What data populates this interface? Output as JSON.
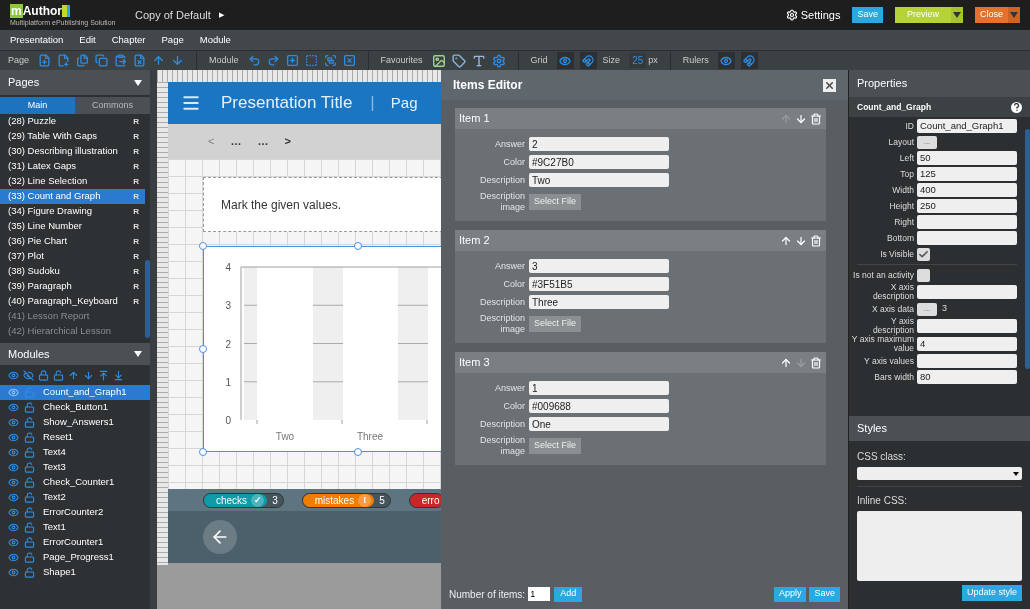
{
  "app": {
    "logo_mark": "m",
    "logo_text": "Author",
    "logo_tagline": "Multiplatform ePublishing Solution",
    "document_title": "Copy of Default",
    "title_arrow": "▶"
  },
  "header_actions": {
    "settings": "Settings",
    "save": "Save",
    "preview": "Preview",
    "close": "Close"
  },
  "menu": [
    "Presentation",
    "Edit",
    "Chapter",
    "Page",
    "Module"
  ],
  "toolbar": {
    "page_label": "Page",
    "module_label": "Module",
    "favourites_label": "Favourites",
    "grid_label": "Grid",
    "size_label": "Size",
    "size_value": "25",
    "size_unit": "px",
    "rulers_label": "Rulers"
  },
  "pages_panel": {
    "title": "Pages",
    "tabs": [
      {
        "label": "Main",
        "selected": true
      },
      {
        "label": "Commons",
        "selected": false
      }
    ],
    "items": [
      {
        "label": "(28) Puzzle",
        "badge": "R",
        "selected": false,
        "disabled": false
      },
      {
        "label": "(29) Table With Gaps",
        "badge": "R",
        "selected": false,
        "disabled": false
      },
      {
        "label": "(30) Describing illustration",
        "badge": "R",
        "selected": false,
        "disabled": false
      },
      {
        "label": "(31) Latex Gaps",
        "badge": "R",
        "selected": false,
        "disabled": false
      },
      {
        "label": "(32) Line Selection",
        "badge": "R",
        "selected": false,
        "disabled": false
      },
      {
        "label": "(33) Count and Graph",
        "badge": "R",
        "selected": true,
        "disabled": false
      },
      {
        "label": "(34) Figure Drawing",
        "badge": "R",
        "selected": false,
        "disabled": false
      },
      {
        "label": "(35) Line Number",
        "badge": "R",
        "selected": false,
        "disabled": false
      },
      {
        "label": "(36) Pie Chart",
        "badge": "R",
        "selected": false,
        "disabled": false
      },
      {
        "label": "(37) Plot",
        "badge": "R",
        "selected": false,
        "disabled": false
      },
      {
        "label": "(38) Sudoku",
        "badge": "R",
        "selected": false,
        "disabled": false
      },
      {
        "label": "(39) Paragraph",
        "badge": "R",
        "selected": false,
        "disabled": false
      },
      {
        "label": "(40) Paragraph_Keyboard",
        "badge": "R",
        "selected": false,
        "disabled": false
      },
      {
        "label": "(41) Lesson Report",
        "selected": false,
        "disabled": true
      },
      {
        "label": "(42) Hierarchical Lesson",
        "selected": false,
        "disabled": true
      }
    ]
  },
  "modules_panel": {
    "title": "Modules",
    "items": [
      {
        "label": "Count_and_Graph1",
        "selected": true
      },
      {
        "label": "Check_Button1",
        "selected": false
      },
      {
        "label": "Show_Answers1",
        "selected": false
      },
      {
        "label": "Reset1",
        "selected": false
      },
      {
        "label": "Text4",
        "selected": false
      },
      {
        "label": "Text3",
        "selected": false
      },
      {
        "label": "Check_Counter1",
        "selected": false
      },
      {
        "label": "Text2",
        "selected": false
      },
      {
        "label": "ErrorCounter2",
        "selected": false
      },
      {
        "label": "Text1",
        "selected": false
      },
      {
        "label": "ErrorCounter1",
        "selected": false
      },
      {
        "label": "Page_Progress1",
        "selected": false
      },
      {
        "label": "Shape1",
        "selected": false
      }
    ]
  },
  "page_preview": {
    "title": "Presentation Title",
    "separator": "|",
    "title_cut": "Pag",
    "nav": [
      {
        "label": "<",
        "disabled": true
      },
      {
        "label": "…",
        "disabled": false
      },
      {
        "label": "…",
        "disabled": false
      },
      {
        "label": ">",
        "disabled": false
      }
    ],
    "instruction": "Mark the given values.",
    "chart": {
      "y_labels": [
        "4",
        "3",
        "2",
        "1",
        "0"
      ],
      "x_labels": [
        "Two",
        "Three"
      ]
    },
    "counters": [
      {
        "label": "checks",
        "symbol": "✓",
        "count": "3",
        "color": "#0e9aa7"
      },
      {
        "label": "mistakes",
        "symbol": "!",
        "count": "5",
        "color": "#ef7d00"
      },
      {
        "label": "erro",
        "color": "#c62828"
      }
    ]
  },
  "items_editor": {
    "title": "Items Editor",
    "items": [
      {
        "title": "Item 1",
        "up_disabled": true,
        "down_disabled": false,
        "fields": [
          {
            "label": "Answer",
            "kind": "text",
            "value": "2"
          },
          {
            "label": "Color",
            "kind": "text",
            "value": "#9C27B0"
          },
          {
            "label": "Description",
            "kind": "text",
            "value": "Two"
          },
          {
            "label": "Description image",
            "kind": "file",
            "button": "Select File"
          }
        ]
      },
      {
        "title": "Item 2",
        "up_disabled": false,
        "down_disabled": false,
        "fields": [
          {
            "label": "Answer",
            "kind": "text",
            "value": "3"
          },
          {
            "label": "Color",
            "kind": "text",
            "value": "#3F51B5"
          },
          {
            "label": "Description",
            "kind": "text",
            "value": "Three"
          },
          {
            "label": "Description image",
            "kind": "file",
            "button": "Select File"
          }
        ]
      },
      {
        "title": "Item 3",
        "up_disabled": false,
        "down_disabled": true,
        "fields": [
          {
            "label": "Answer",
            "kind": "text",
            "value": "1"
          },
          {
            "label": "Color",
            "kind": "text",
            "value": "#009688"
          },
          {
            "label": "Description",
            "kind": "text",
            "value": "One"
          },
          {
            "label": "Description image",
            "kind": "file",
            "button": "Select File"
          }
        ]
      }
    ],
    "footer": {
      "count_label": "Number of items:",
      "count_value": "1",
      "add": "Add",
      "apply": "Apply",
      "save": "Save"
    }
  },
  "properties": {
    "title": "Properties",
    "module_type": "Count_and_Graph",
    "general": [
      {
        "label": "ID",
        "kind": "text",
        "value": "Count_and_Graph1"
      },
      {
        "label": "Layout",
        "kind": "button",
        "button": "..."
      },
      {
        "label": "Left",
        "kind": "text",
        "value": "50"
      },
      {
        "label": "Top",
        "kind": "text",
        "value": "125"
      },
      {
        "label": "Width",
        "kind": "text",
        "value": "400"
      },
      {
        "label": "Height",
        "kind": "text",
        "value": "250"
      },
      {
        "label": "Right",
        "kind": "text"
      },
      {
        "label": "Bottom",
        "kind": "text"
      },
      {
        "label": "Is Visible",
        "kind": "checkbox",
        "checked": true
      }
    ],
    "module": [
      {
        "label": "Is not an activity",
        "kind": "checkbox",
        "checked": false
      },
      {
        "label": "X axis description",
        "kind": "text"
      },
      {
        "label": "X axis data",
        "kind": "button",
        "button": "...",
        "note": "3"
      },
      {
        "label": "Y axis description",
        "kind": "text"
      },
      {
        "label": "Y axis maximum value",
        "kind": "text",
        "value": "4"
      },
      {
        "label": "Y axis values",
        "kind": "text"
      },
      {
        "label": "Bars width",
        "kind": "text",
        "value": "80"
      }
    ]
  },
  "styles": {
    "title": "Styles",
    "css_class_label": "CSS class:",
    "inline_css_label": "Inline CSS:",
    "update_button": "Update style"
  }
}
